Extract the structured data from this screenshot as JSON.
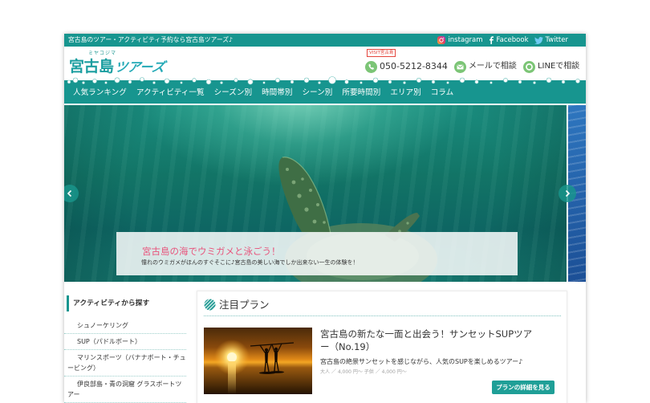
{
  "colors": {
    "primary": "#17958f",
    "accent_pink": "#e8547c",
    "contact_green": "#7cc576",
    "badge_red": "#e4463d",
    "button": "#1f9f97",
    "text": "#333333",
    "muted": "#a3a3a3"
  },
  "topbar": {
    "tagline": "宮古島のツアー・アクティビティ予約なら宮古島ツアーズ♪",
    "social": [
      {
        "icon": "instagram-icon",
        "label": "instagram"
      },
      {
        "icon": "facebook-icon",
        "label": "Facebook"
      },
      {
        "icon": "twitter-icon",
        "label": "Twitter"
      }
    ]
  },
  "header": {
    "logo": {
      "ruby": "ミヤコジマ",
      "main": "宮古島",
      "sub": "ツアーズ"
    },
    "badge": "VISIT宮古島",
    "contacts": [
      {
        "icon": "phone-icon",
        "label": "050-5212-8344"
      },
      {
        "icon": "mail-icon",
        "label": "メールで相談"
      },
      {
        "icon": "line-icon",
        "label": "LINEで相談"
      }
    ]
  },
  "nav": {
    "items": [
      "人気ランキング",
      "アクティビティ一覧",
      "シーズン別",
      "時間帯別",
      "シーン別",
      "所要時間別",
      "エリア別",
      "コラム"
    ]
  },
  "hero": {
    "title": "宮古島の海でウミガメと泳ごう！",
    "subtitle": "憧れのウミガメがほんのすぐそこに♪宮古島の美しい海でしか出来ない一生の体験を！",
    "prev_icon": "chevron-left-icon",
    "next_icon": "chevron-right-icon"
  },
  "sidebar": {
    "heading": "アクティビティから探す",
    "items": [
      "シュノーケリング",
      "SUP（パドルボート）",
      "マリンスポーツ（バナナボート・チュービング）",
      "伊良部島・青の洞窟 グラスボートツアー"
    ]
  },
  "featured": {
    "icon": "wave-icon",
    "heading": "注目プラン",
    "card": {
      "title": "宮古島の新たな一面と出会う！サンセットSUPツアー（No.19）",
      "description": "宮古島の絶景サンセットを感じながら、人気のSUPを楽しめるツアー♪",
      "price": "大人 ／ 4,000 円〜 子供 ／ 4,000 円〜",
      "button": "プランの詳細を見る"
    }
  }
}
